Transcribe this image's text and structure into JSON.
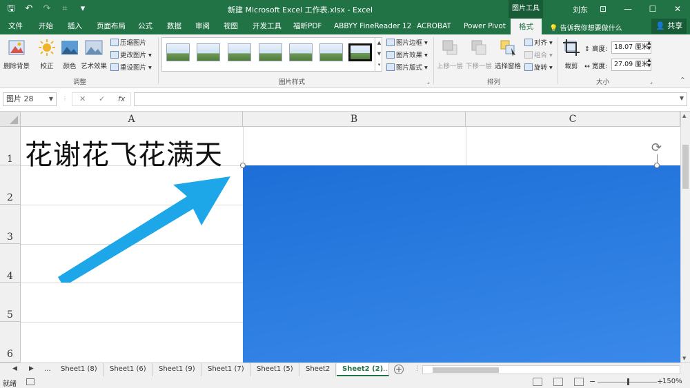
{
  "window": {
    "title": "新建 Microsoft Excel 工作表.xlsx  -  Excel",
    "context_tab": "图片工具",
    "user": "刘东"
  },
  "tabs": [
    "文件",
    "开始",
    "插入",
    "页面布局",
    "公式",
    "数据",
    "审阅",
    "视图",
    "开发工具",
    "福昕PDF",
    "ABBYY FineReader 12",
    "ACROBAT",
    "Power Pivot",
    "格式"
  ],
  "tell_me": "告诉我你想要做什么",
  "share": "共享",
  "ribbon": {
    "remove_bg": "删除背景",
    "corrections": "校正",
    "color": "颜色",
    "artistic": "艺术效果",
    "compress": "压缩图片",
    "change": "更改图片",
    "reset": "重设图片",
    "group_adjust": "调整",
    "group_styles": "图片样式",
    "border": "图片边框",
    "effects": "图片效果",
    "layout": "图片版式",
    "bring_forward": "上移一层",
    "send_backward": "下移一层",
    "selection_pane": "选择窗格",
    "align": "对齐",
    "group": "组合",
    "rotate": "旋转",
    "group_arrange": "排列",
    "crop": "裁剪",
    "height_label": "高度:",
    "height_value": "18.07 厘米",
    "width_label": "宽度:",
    "width_value": "27.09 厘米",
    "group_size": "大小"
  },
  "formula_bar": {
    "name_box": "图片 28",
    "fx": "fx",
    "formula": ""
  },
  "sheet": {
    "columns": [
      "A",
      "B",
      "C"
    ],
    "rows": [
      "1",
      "2",
      "3",
      "4",
      "5",
      "6"
    ],
    "cell_a1": "花谢花飞花满天"
  },
  "arrow_color": "#1ea7e8",
  "sheet_tabs": [
    "...",
    "Sheet1 (8)",
    "Sheet1 (6)",
    "Sheet1 (9)",
    "Sheet1 (7)",
    "Sheet1 (5)",
    "Sheet2",
    "Sheet2 (2)",
    "..."
  ],
  "status": {
    "ready": "就绪",
    "zoom": "150%"
  }
}
